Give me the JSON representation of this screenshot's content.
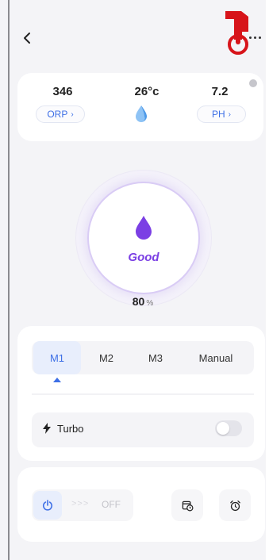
{
  "header": {
    "back_icon": "chevron-left-icon",
    "more_icon": "more-dots-icon",
    "overlay_icon": "pointing-hand-icon"
  },
  "metrics": {
    "orp": {
      "value": "346",
      "label": "ORP"
    },
    "temperature": {
      "value": "26°c",
      "icon": "water-drop-icon"
    },
    "ph": {
      "value": "7.2",
      "label": "PH"
    },
    "info_icon": "info-dot-icon"
  },
  "gauge": {
    "status": "Good",
    "percent_value": "80",
    "percent_unit": "%",
    "level_fraction": 0.8,
    "icon": "water-drop-icon"
  },
  "modes": {
    "tabs": [
      "M1",
      "M2",
      "M3",
      "Manual"
    ],
    "active_tab": "M1",
    "turbo_label": "Turbo",
    "turbo_on": false
  },
  "controls": {
    "power_state": "OFF",
    "power_arrows": ">>>",
    "schedule_icon": "calendar-clock-icon",
    "alarm_icon": "alarm-clock-icon"
  },
  "colors": {
    "accent": "#3d6fe6",
    "status": "#7b3fe4",
    "overlay": "#d7141a"
  }
}
